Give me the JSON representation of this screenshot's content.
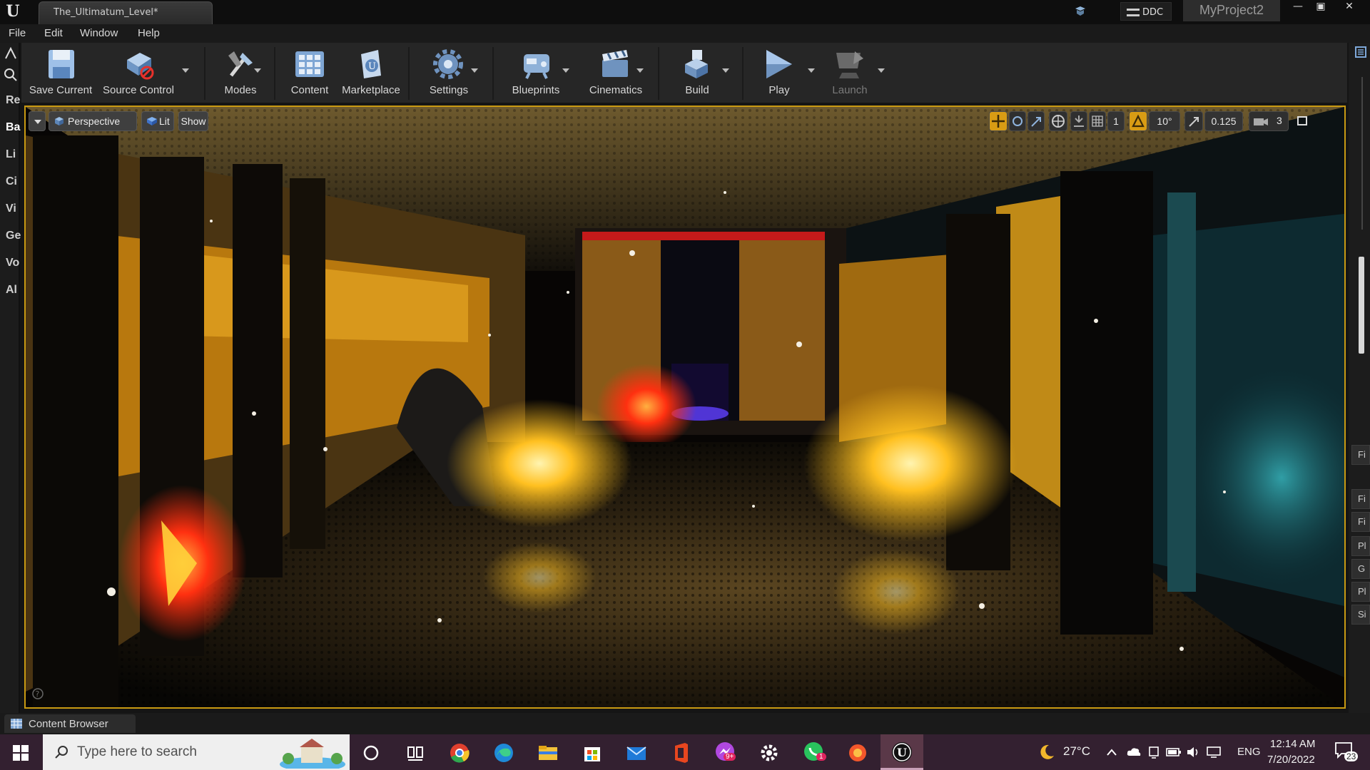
{
  "window": {
    "level_tab": "The_Ultimatum_Level*",
    "ddc_label": "DDC",
    "project_name": "MyProject2"
  },
  "menu": [
    "File",
    "Edit",
    "Window",
    "Help"
  ],
  "left_tabs": [
    "Re",
    "Ba",
    "Li",
    "Ci",
    "Vi",
    "Ge",
    "Vo",
    "Al"
  ],
  "toolbar": {
    "save_current": "Save Current",
    "source_control": "Source Control",
    "modes": "Modes",
    "content": "Content",
    "marketplace": "Marketplace",
    "settings": "Settings",
    "blueprints": "Blueprints",
    "cinematics": "Cinematics",
    "build": "Build",
    "play": "Play",
    "launch": "Launch"
  },
  "viewport": {
    "perspective": "Perspective",
    "lit": "Lit",
    "show": "Show",
    "grid_snap_value": "1",
    "rotation_snap_value": "10°",
    "scale_snap_value": "0.125",
    "camera_speed": "3"
  },
  "right_tabs": [
    "Fi",
    "Fi",
    "Fi",
    "Pl",
    "G",
    "Pl",
    "Si"
  ],
  "bottom": {
    "content_browser": "Content Browser"
  },
  "taskbar": {
    "search_placeholder": "Type here to search",
    "temperature": "27°C",
    "language": "ENG",
    "time": "12:14 AM",
    "date": "7/20/2022",
    "notification_count": "23",
    "whatsapp_badge": "1",
    "messenger_badge": "9+"
  },
  "colors": {
    "accent": "#d89c14",
    "viewport_border": "#c99a12",
    "taskbar": "#332030"
  }
}
